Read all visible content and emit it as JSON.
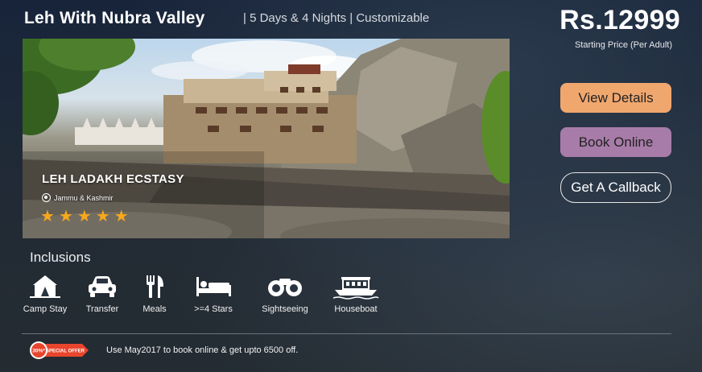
{
  "package": {
    "title": "Leh With Nubra Valley",
    "meta": "| 5 Days & 4 Nights | Customizable"
  },
  "price": {
    "amount": "Rs.12999",
    "note": "Starting Price (Per Adult)"
  },
  "hero": {
    "name": "LEH LADAKH ECSTASY",
    "location": "Jammu & Kashmir",
    "rating": 5,
    "stars": [
      "★",
      "★",
      "★",
      "★",
      "★"
    ],
    "star_color": "#f7a81b"
  },
  "actions": {
    "view_details": "View Details",
    "book_online": "Book Online",
    "get_callback": "Get A Callback"
  },
  "inclusions": {
    "title": "Inclusions",
    "items": [
      {
        "label": "Camp Stay",
        "icon": "tent-icon"
      },
      {
        "label": "Transfer",
        "icon": "car-icon"
      },
      {
        "label": "Meals",
        "icon": "cutlery-icon"
      },
      {
        "label": ">=4 Stars",
        "icon": "bed-icon"
      },
      {
        "label": "Sightseeing",
        "icon": "binoculars-icon"
      },
      {
        "label": "Houseboat",
        "icon": "houseboat-icon"
      }
    ]
  },
  "offer": {
    "badge_percent": "30%*",
    "badge_label": "SPECIAL OFFER",
    "text": "Use May2017 to book online & get upto 6500 off."
  },
  "colors": {
    "view_details_bg": "#f0a76e",
    "book_online_bg": "#a87ca8",
    "badge_red": "#e8452c"
  }
}
